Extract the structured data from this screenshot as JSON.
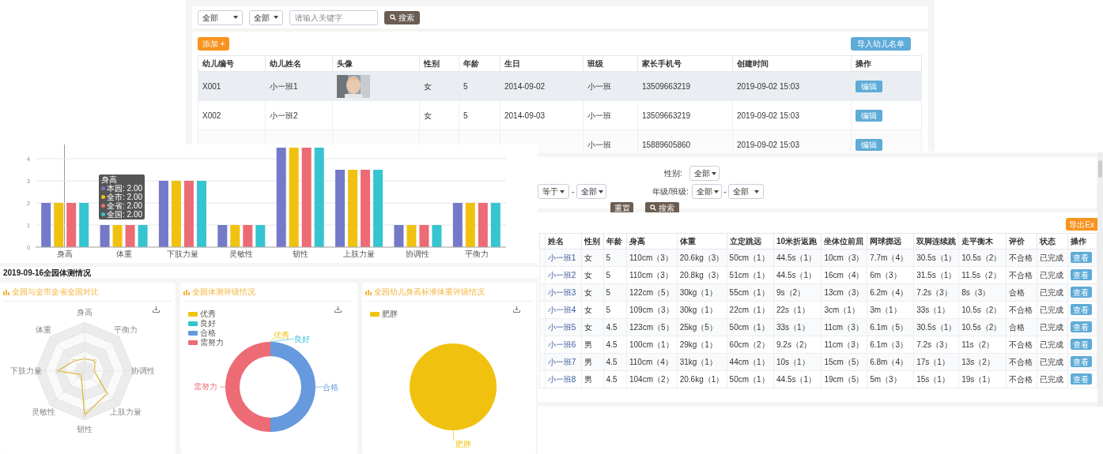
{
  "student_list": {
    "filters": [
      {
        "value": "全部"
      },
      {
        "value": "全部"
      }
    ],
    "search": {
      "placeholder": "请输入关键字"
    },
    "search_button": "搜索",
    "add_button": {
      "label": "添加",
      "icon": "+"
    },
    "import_button": "导入幼儿名单",
    "columns": [
      "幼儿编号",
      "幼儿姓名",
      "头像",
      "性别",
      "年龄",
      "生日",
      "班级",
      "家长手机号",
      "创建时间",
      "操作"
    ],
    "rows": [
      {
        "selected": true,
        "has_avatar": true,
        "cells": [
          "X001",
          "小一班1",
          "",
          "女",
          "5",
          "2014-09-02",
          "小一班",
          "13509663219",
          "2019-09-02 15:03"
        ],
        "action": "编辑"
      },
      {
        "selected": false,
        "has_avatar": false,
        "cells": [
          "X002",
          "小一班2",
          "",
          "女",
          "5",
          "2014-09-03",
          "小一班",
          "13509663219",
          "2019-09-02 15:03"
        ],
        "action": "编辑"
      },
      {
        "selected": false,
        "has_avatar": false,
        "cells": [
          null,
          null,
          "",
          null,
          null,
          null,
          "小一班",
          "15889605860",
          "2019-09-02 15:03"
        ],
        "action": "编辑"
      }
    ]
  },
  "report": {
    "bar_chart": {
      "chart_data": {
        "type": "bar",
        "grid": true,
        "categories": [
          "身高",
          "体重",
          "下肢力量",
          "灵敏性",
          "韧性",
          "上肢力量",
          "协调性",
          "平衡力"
        ],
        "ylim": [
          0,
          4.5
        ],
        "yticks": [
          0,
          1,
          2,
          3,
          4
        ],
        "series": [
          {
            "name": "本园",
            "color": "#7479c8",
            "values": [
              2,
              1,
              3,
              1,
              4.5,
              3.5,
              1,
              2
            ]
          },
          {
            "name": "全市",
            "color": "#f0c20f",
            "values": [
              2,
              1,
              3,
              1,
              4.5,
              3.5,
              1,
              2
            ]
          },
          {
            "name": "全省",
            "color": "#ec6b75",
            "values": [
              2,
              1,
              3,
              1,
              4.5,
              3.5,
              1,
              2
            ]
          },
          {
            "name": "全国",
            "color": "#35c4d0",
            "values": [
              2,
              1,
              3,
              1,
              4.5,
              3.5,
              1,
              2
            ]
          }
        ]
      },
      "tooltip": {
        "title": "身高",
        "rows": [
          {
            "separator": ":",
            "value": "2.00"
          },
          {
            "separator": ":",
            "value": "2.00"
          },
          {
            "separator": ":",
            "value": "2.00"
          },
          {
            "separator": ":",
            "value": "2.00"
          }
        ]
      }
    },
    "section_title": "2019-09-16全园体测情况",
    "cards": [
      {
        "kind": "radar",
        "title": "全园与全市全省全国对比",
        "axes": [
          "身高",
          "平衡力",
          "协调性",
          "上肢力量",
          "韧性",
          "灵敏性",
          "下肢力量",
          "体重"
        ]
      },
      {
        "kind": "donut",
        "title": "全园体测评级情况",
        "legend": [
          {
            "label": "优秀",
            "color": "#f0c20f"
          },
          {
            "label": "良好",
            "color": "#35c4d0"
          },
          {
            "label": "合格",
            "color": "#6699de"
          },
          {
            "label": "需努力",
            "color": "#ec6b75"
          }
        ],
        "labels": [
          "优秀",
          "良好",
          "合格",
          "需努力"
        ]
      },
      {
        "kind": "pie",
        "title": "全园幼儿身高标准体重评级情况",
        "legend": [
          {
            "label": "肥胖",
            "color": "#f0c20f"
          }
        ],
        "labels": [
          "肥胖"
        ]
      }
    ]
  },
  "scores": {
    "gender_label": "性别:",
    "gender": "全部",
    "operator": "等于",
    "operator_dash": "-",
    "operator_value": "全部",
    "class_label": "年级/班级:",
    "grade": "全部",
    "class_dash": "-",
    "class": "全部",
    "reset_button": "重置",
    "search_button": "搜索",
    "export_button": "导出Ex",
    "columns": [
      "姓名",
      "性别",
      "年龄",
      "身高",
      "体重",
      "立定跳远",
      "10米折返跑",
      "坐体位前屈",
      "网球掷远",
      "双脚连续跳",
      "走平衡木",
      "评价",
      "状态",
      "操作"
    ],
    "rows": [
      {
        "cells": [
          "小一班1",
          "女",
          "5",
          "110cm（3）",
          "20.6kg（3）",
          "50cm（1）",
          "44.5s（1）",
          "10cm（3）",
          "7.7m（4）",
          "30.5s（1）",
          "10.5s（2）",
          "不合格",
          "已完成"
        ],
        "action": "查看"
      },
      {
        "cells": [
          "小一班2",
          "女",
          "5",
          "110cm（3）",
          "20.8kg（3）",
          "51cm（1）",
          "44.5s（1）",
          "16cm（4）",
          "6m（3）",
          "31.5s（1）",
          "11.5s（2）",
          "不合格",
          "已完成"
        ],
        "action": "查看"
      },
      {
        "cells": [
          "小一班3",
          "女",
          "5",
          "122cm（5）",
          "30kg（1）",
          "55cm（1）",
          "9s（2）",
          "13cm（3）",
          "6.2m（4）",
          "7.2s（3）",
          "8s（3）",
          "合格",
          "已完成"
        ],
        "action": "查看"
      },
      {
        "cells": [
          "小一班4",
          "女",
          "5",
          "109cm（3）",
          "30kg（1）",
          "22cm（1）",
          "22s（1）",
          "3cm（1）",
          "3m（1）",
          "33s（1）",
          "10.5s（2）",
          "不合格",
          "已完成"
        ],
        "action": "查看"
      },
      {
        "cells": [
          "小一班5",
          "女",
          "4.5",
          "123cm（5）",
          "25kg（5）",
          "50cm（1）",
          "33s（1）",
          "11cm（3）",
          "6.1m（5）",
          "30.5s（1）",
          "10.5s（2）",
          "合格",
          "已完成"
        ],
        "action": "查看"
      },
      {
        "cells": [
          "小一班6",
          "男",
          "4.5",
          "100cm（1）",
          "29kg（1）",
          "60cm（2）",
          "9.2s（2）",
          "11cm（3）",
          "6.1m（3）",
          "7.2s（3）",
          "11s（2）",
          "不合格",
          "已完成"
        ],
        "action": "查看"
      },
      {
        "cells": [
          "小一班7",
          "男",
          "4.5",
          "110cm（4）",
          "31kg（1）",
          "44cm（1）",
          "10s（1）",
          "15cm（5）",
          "6.8m（4）",
          "17s（1）",
          "13s（2）",
          "不合格",
          "已完成"
        ],
        "action": "查看"
      },
      {
        "cells": [
          "小一班8",
          "男",
          "4.5",
          "104cm（2）",
          "20.6kg（1）",
          "50cm（1）",
          "44.5s（1）",
          "19cm（5）",
          "5m（3）",
          "15s（1）",
          "19s（1）",
          "不合格",
          "已完成"
        ],
        "action": "查看"
      }
    ]
  }
}
